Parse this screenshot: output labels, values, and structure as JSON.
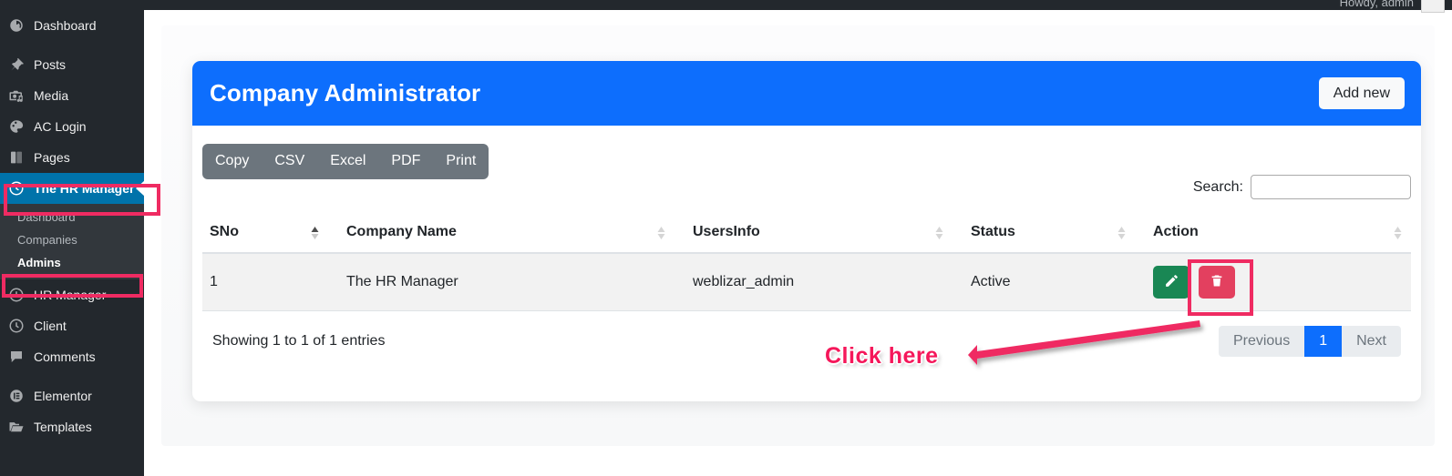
{
  "adminbar": {
    "greeting": "Howdy, admin",
    "avatar_icon": "user-avatar-icon"
  },
  "sidebar": {
    "items": [
      {
        "label": "Dashboard",
        "icon": "dashboard-gauge-icon",
        "active": false
      },
      {
        "label": "Posts",
        "icon": "pin-icon",
        "active": false
      },
      {
        "label": "Media",
        "icon": "media-camera-icon",
        "active": false
      },
      {
        "label": "AC Login",
        "icon": "palette-icon",
        "active": false
      },
      {
        "label": "Pages",
        "icon": "pages-book-icon",
        "active": false
      },
      {
        "label": "The HR Manager",
        "icon": "clock-icon",
        "active": true
      },
      {
        "label": "HR Manager",
        "icon": "clock-icon",
        "active": false
      },
      {
        "label": "Client",
        "icon": "clock-icon",
        "active": false
      },
      {
        "label": "Comments",
        "icon": "comment-bubble-icon",
        "active": false
      },
      {
        "label": "Elementor",
        "icon": "elementor-icon",
        "active": false
      },
      {
        "label": "Templates",
        "icon": "folder-icon",
        "active": false
      }
    ],
    "submenu": [
      {
        "label": "Dashboard",
        "current": false
      },
      {
        "label": "Companies",
        "current": false
      },
      {
        "label": "Admins",
        "current": true
      }
    ]
  },
  "card": {
    "title": "Company Administrator",
    "add_new_label": "Add new"
  },
  "export_buttons": [
    {
      "label": "Copy"
    },
    {
      "label": "CSV"
    },
    {
      "label": "Excel"
    },
    {
      "label": "PDF"
    },
    {
      "label": "Print"
    }
  ],
  "search": {
    "label": "Search:",
    "value": "",
    "placeholder": ""
  },
  "table": {
    "columns": [
      {
        "label": "SNo",
        "sort": "asc"
      },
      {
        "label": "Company Name",
        "sort": "none"
      },
      {
        "label": "UsersInfo",
        "sort": "none"
      },
      {
        "label": "Status",
        "sort": "none"
      },
      {
        "label": "Action",
        "sort": "none"
      }
    ],
    "rows": [
      {
        "sno": "1",
        "company_name": "The HR Manager",
        "users_info": "weblizar_admin",
        "status": "Active",
        "edit_icon": "pencil-edit-icon",
        "delete_icon": "trash-delete-icon"
      }
    ]
  },
  "footer": {
    "showing": "Showing 1 to 1 of 1 entries",
    "pagination": [
      {
        "label": "Previous",
        "active": false
      },
      {
        "label": "1",
        "active": true
      },
      {
        "label": "Next",
        "active": false
      }
    ]
  },
  "annotations": {
    "click_here": "Click here",
    "highlight_color": "#ef2b62",
    "arrow_color": "#ef2b62"
  },
  "colors": {
    "accent_blue": "#0d6efd",
    "sidebar_bg": "#23282d",
    "submenu_bg": "#32373c",
    "active_menu_blue": "#0073aa",
    "export_bar_gray": "#6c757d",
    "edit_green": "#198754",
    "delete_red": "#e3405f",
    "annotation_pink": "#ef2b62",
    "click_here_pink": "#f5175a"
  }
}
